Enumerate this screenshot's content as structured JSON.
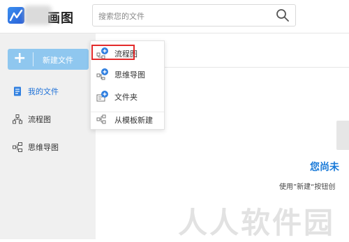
{
  "header": {
    "logo_text": "画图",
    "search_placeholder": "搜索您的文件"
  },
  "sidebar": {
    "new_button_label": "新建文件",
    "items": [
      {
        "label": "我的文件",
        "active": true,
        "icon": "document-icon"
      },
      {
        "label": "流程图",
        "active": false,
        "icon": "flowchart-icon"
      },
      {
        "label": "思维导图",
        "active": false,
        "icon": "mindmap-icon"
      }
    ]
  },
  "dropdown": {
    "items": [
      {
        "label": "流程图",
        "icon": "flowchart-plus-icon"
      },
      {
        "label": "思维导图",
        "icon": "mindmap-plus-icon"
      },
      {
        "label": "文件夹",
        "icon": "folder-plus-icon"
      },
      {
        "label": "从模板新建",
        "icon": "template-icon"
      }
    ]
  },
  "main": {
    "empty_title": "您尚未",
    "empty_desc": "使用”新建“按钮创"
  },
  "watermark": "人人软件园",
  "colors": {
    "accent": "#1f72d8",
    "new_button": "#8fc7ef",
    "highlight": "#e32b2b"
  }
}
